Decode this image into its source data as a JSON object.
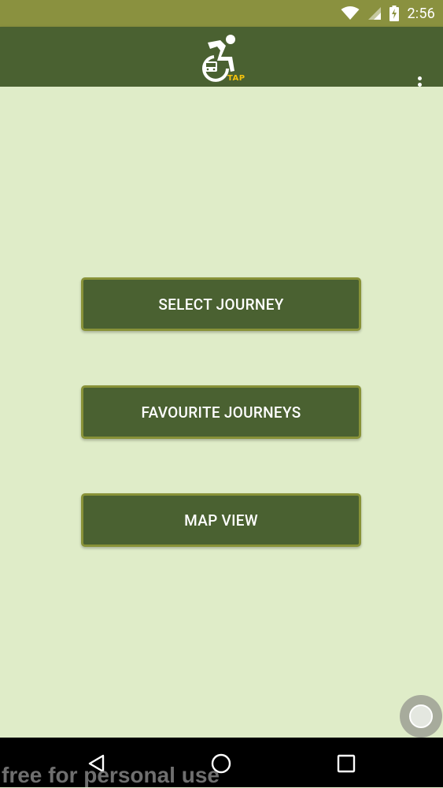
{
  "status_bar": {
    "time": "2:56",
    "icons": [
      "wifi-icon",
      "cellular-signal-icon",
      "battery-charging-icon"
    ]
  },
  "app_bar": {
    "logo_text": "TAP",
    "menu_icon": "overflow-menu-icon"
  },
  "main": {
    "buttons": [
      {
        "label": "SELECT JOURNEY"
      },
      {
        "label": "FAVOURITE JOURNEYS"
      },
      {
        "label": "MAP VIEW"
      }
    ]
  },
  "fab": {
    "icon": "assistive-touch-icon"
  },
  "nav_bar": {
    "back_icon": "back-icon",
    "home_icon": "home-icon",
    "recents_icon": "recents-icon"
  },
  "watermark": {
    "text": "free for personal use"
  },
  "colors": {
    "status_bar": "#8a913f",
    "app_bar": "#4a6131",
    "background": "#dfecc8",
    "button_fill": "#4a6131",
    "button_border": "#889238",
    "logo_accent": "#f4c20d"
  }
}
